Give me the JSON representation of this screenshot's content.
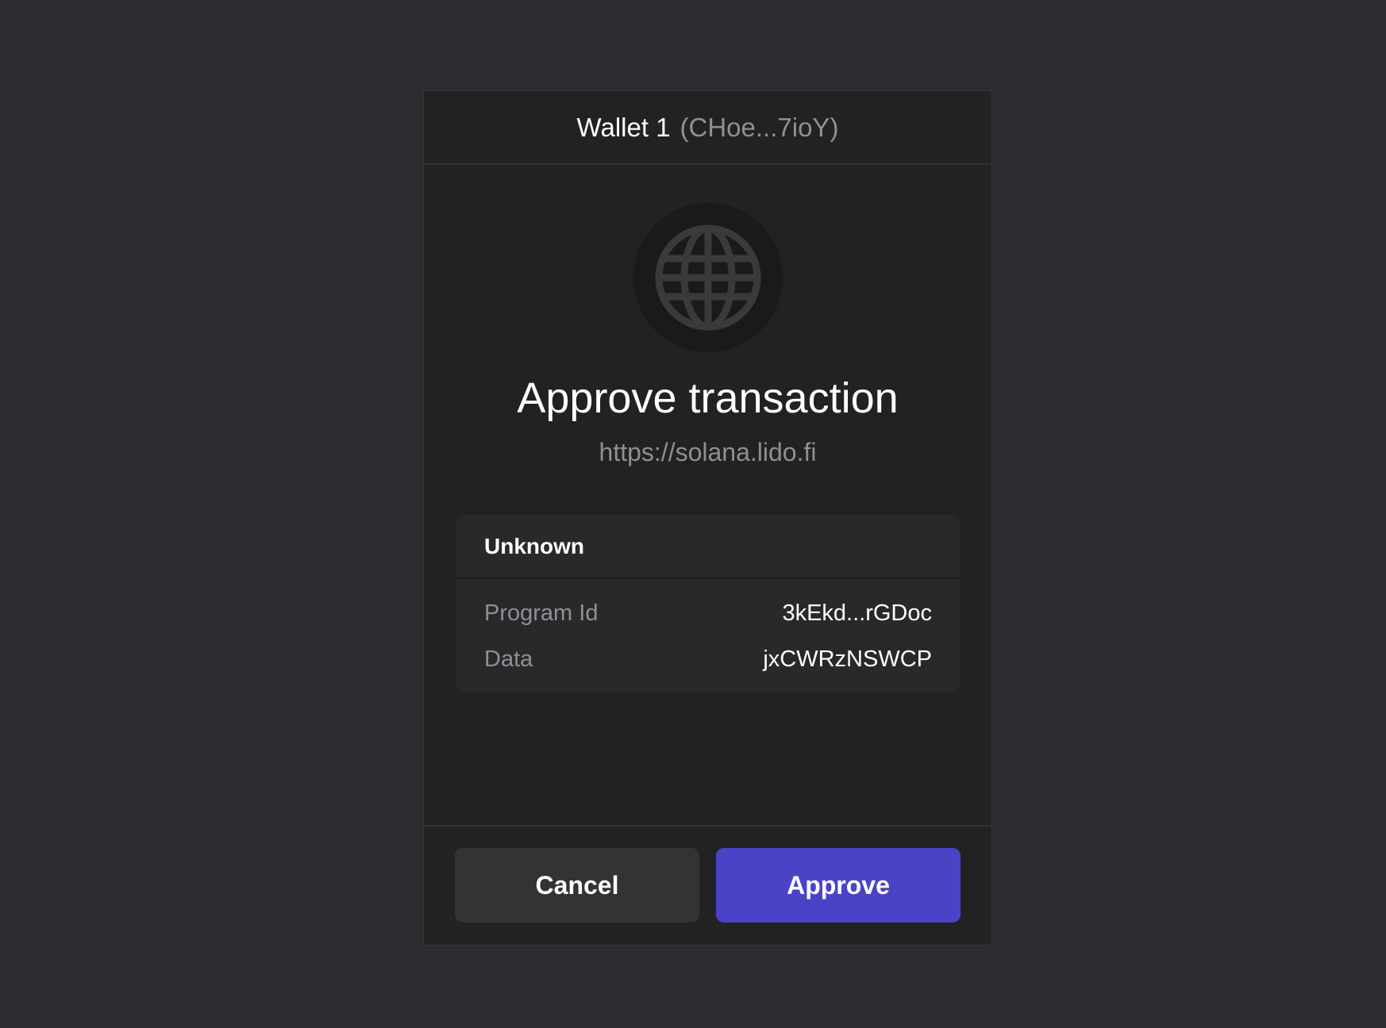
{
  "header": {
    "wallet_name": "Wallet 1",
    "wallet_address": "(CHoe...7ioY)"
  },
  "icon": "globe-icon",
  "main": {
    "title": "Approve transaction",
    "origin": "https://solana.lido.fi"
  },
  "instruction": {
    "name": "Unknown",
    "rows": [
      {
        "label": "Program Id",
        "value": "3kEkd...rGDoc"
      },
      {
        "label": "Data",
        "value": "jxCWRzNSWCP"
      }
    ]
  },
  "buttons": {
    "cancel": "Cancel",
    "approve": "Approve"
  },
  "colors": {
    "background": "#2b2c30",
    "panel": "#222223",
    "card": "#29292b",
    "approve": "#4b43c7",
    "cancel": "#333335",
    "muted_text": "#8f9094"
  }
}
